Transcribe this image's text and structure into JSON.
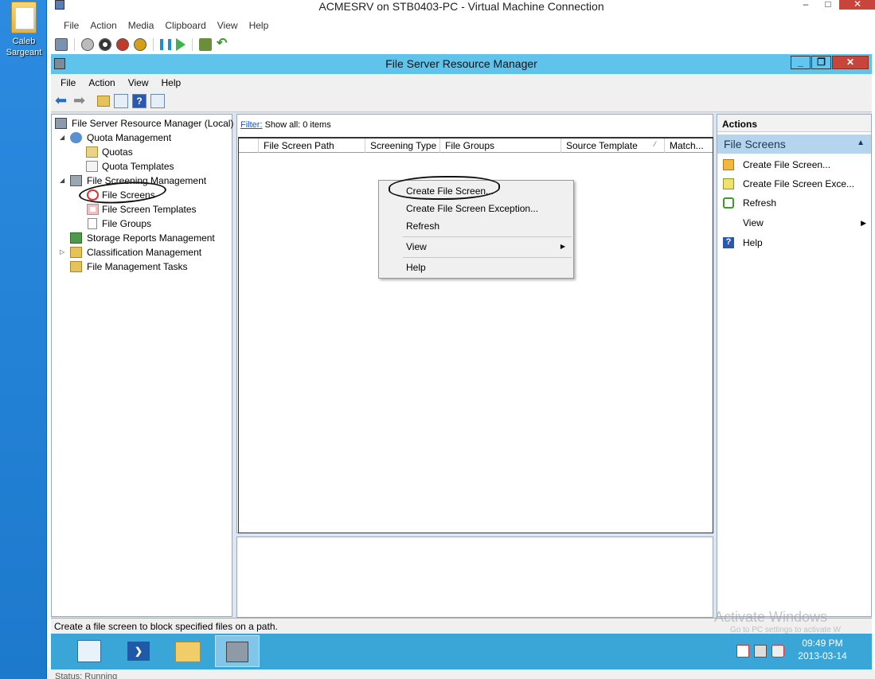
{
  "desktop": {
    "icon_label": "Caleb Sargeant"
  },
  "vm_window": {
    "title": "ACMESRV on STB0403-PC - Virtual Machine Connection",
    "menu": [
      "File",
      "Action",
      "Media",
      "Clipboard",
      "View",
      "Help"
    ],
    "status": "Status: Running"
  },
  "fsrm": {
    "title": "File Server Resource Manager",
    "menu": [
      "File",
      "Action",
      "View",
      "Help"
    ],
    "tree": [
      {
        "label": "File Server Resource Manager (Local)",
        "icon": "server-icon"
      },
      {
        "label": "Quota Management",
        "icon": "quota-icon"
      },
      {
        "label": "Quotas",
        "icon": "quotas-icon"
      },
      {
        "label": "Quota Templates",
        "icon": "quota-template-icon"
      },
      {
        "label": "File Screening Management",
        "icon": "file-screening-icon"
      },
      {
        "label": "File Screens",
        "icon": "file-screen-icon"
      },
      {
        "label": "File Screen Templates",
        "icon": "file-screen-template-icon"
      },
      {
        "label": "File Groups",
        "icon": "file-group-icon"
      },
      {
        "label": "Storage Reports Management",
        "icon": "storage-reports-icon"
      },
      {
        "label": "Classification Management",
        "icon": "classification-icon"
      },
      {
        "label": "File Management Tasks",
        "icon": "file-tasks-icon"
      }
    ],
    "filter_link": "Filter:",
    "filter_text": "Show all: 0 items",
    "columns": [
      "File Screen Path",
      "Screening Type",
      "File Groups",
      "Source Template",
      "Match..."
    ],
    "actions": {
      "header": "Actions",
      "section": "File Screens",
      "items": [
        "Create File Screen...",
        "Create File Screen Exce...",
        "Refresh",
        "View",
        "Help"
      ]
    },
    "status_text": "Create a file screen to block specified files on a path.",
    "context_menu": [
      "Create File Screen...",
      "Create File Screen Exception...",
      "Refresh",
      "View",
      "Help"
    ]
  },
  "taskbar": {
    "time": "09:49 PM",
    "date": "2013-03-14"
  },
  "watermark": {
    "line1": "Activate Windows",
    "line2": "Go to PC settings to activate W"
  },
  "colors": {
    "titlebar": "#5fc3ec",
    "taskbar": "#3aa6d8",
    "action_section": "#b5d4ee",
    "close_button": "#c7453b"
  }
}
